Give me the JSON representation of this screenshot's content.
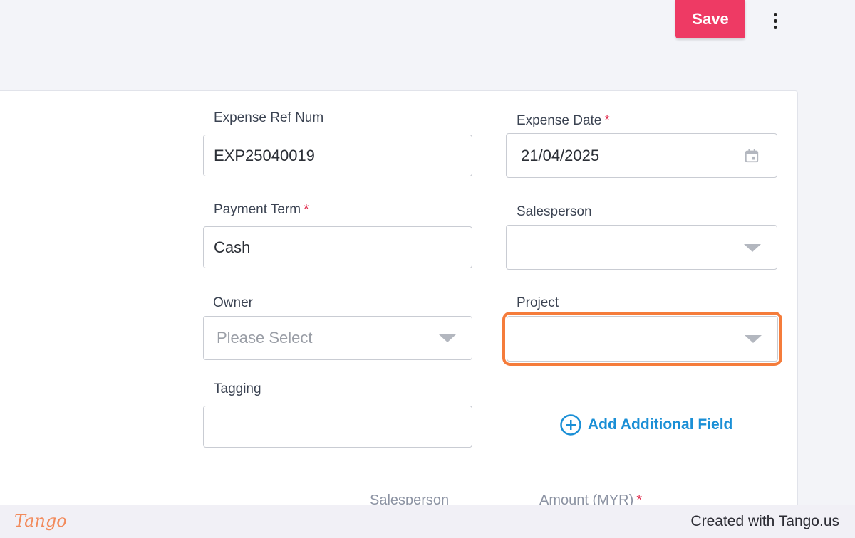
{
  "toolbar": {
    "save_label": "Save",
    "save_color": "#ee3a64",
    "more_icon": "kebab-menu-icon"
  },
  "form": {
    "expense_ref": {
      "label": "Expense Ref Num",
      "value": "EXP25040019"
    },
    "expense_date": {
      "label": "Expense Date",
      "required_mark": "*",
      "value": "21/04/2025",
      "icon": "calendar-icon"
    },
    "payment_term": {
      "label": "Payment Term",
      "required_mark": "*",
      "value": "Cash"
    },
    "salesperson": {
      "label": "Salesperson",
      "value": ""
    },
    "owner": {
      "label": "Owner",
      "placeholder": "Please Select"
    },
    "project": {
      "label": "Project",
      "value": ""
    },
    "tagging": {
      "label": "Tagging",
      "value": ""
    },
    "add_field": {
      "label": "Add Additional Field",
      "icon": "plus-circle-icon"
    }
  },
  "table_headers": {
    "salesperson": "Salesperson",
    "amount": "Amount (MYR)",
    "amount_required_mark": "*"
  },
  "footer": {
    "logo_text": "Tango",
    "created_with": "Created with Tango.us"
  },
  "colors": {
    "accent": "#1a8fd6",
    "highlight": "#f57c3b",
    "required": "#e0284a"
  }
}
